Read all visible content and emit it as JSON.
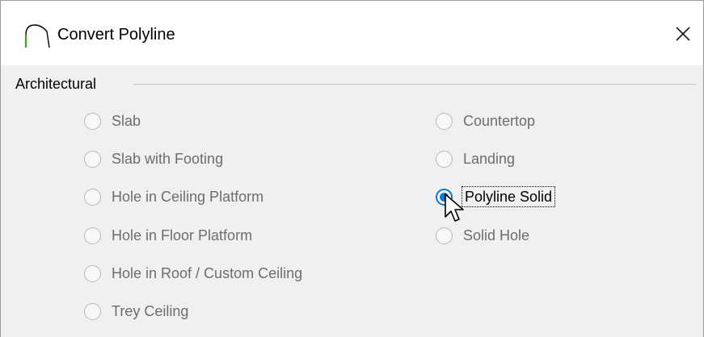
{
  "window": {
    "title": "Convert Polyline",
    "icon": "polyline-arc-icon",
    "close_icon": "close-icon"
  },
  "group": {
    "label": "Architectural"
  },
  "options": {
    "left": [
      {
        "label": "Slab",
        "selected": false
      },
      {
        "label": "Slab with Footing",
        "selected": false
      },
      {
        "label": "Hole in Ceiling Platform",
        "selected": false
      },
      {
        "label": "Hole in Floor Platform",
        "selected": false
      },
      {
        "label": "Hole in Roof / Custom Ceiling",
        "selected": false
      },
      {
        "label": "Trey Ceiling",
        "selected": false
      }
    ],
    "right": [
      {
        "label": "Countertop",
        "selected": false
      },
      {
        "label": "Landing",
        "selected": false
      },
      {
        "label": "Polyline Solid",
        "selected": true
      },
      {
        "label": "Solid Hole",
        "selected": false
      }
    ]
  },
  "colors": {
    "accent": "#0a78d7",
    "disabled_text": "#6d6d6d"
  },
  "cursor": "arrow-pointer-icon"
}
